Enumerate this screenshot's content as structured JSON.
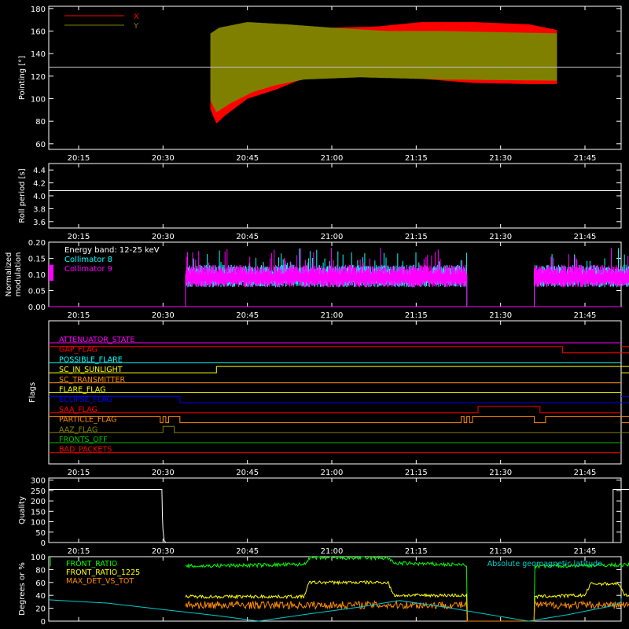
{
  "x_tick_labels": [
    "20:15",
    "20:30",
    "20:45",
    "21:00",
    "21:15",
    "21:30",
    "21:45"
  ],
  "chart_data": [
    {
      "type": "line",
      "ylabel": "Pointing [°]",
      "yticks": [
        "60",
        "80",
        "100",
        "120",
        "140",
        "160",
        "180"
      ],
      "ylim": [
        55,
        182
      ],
      "legend": [
        {
          "name": "X",
          "color": "#ff0000"
        },
        {
          "name": "Y",
          "color": "#808000"
        }
      ],
      "reference_line": 128,
      "series": [
        {
          "name": "X",
          "color": "#ff0000",
          "upper": [
            [
              28.5,
              152
            ],
            [
              29.5,
              158
            ],
            [
              32,
              162
            ],
            [
              40,
              165
            ],
            [
              50,
              163
            ],
            [
              58,
              164
            ],
            [
              66,
              168
            ],
            [
              75,
              168
            ],
            [
              85,
              166
            ],
            [
              90,
              161
            ]
          ],
          "lower": [
            [
              28.5,
              90
            ],
            [
              29.5,
              78
            ],
            [
              31,
              85
            ],
            [
              35,
              100
            ],
            [
              40,
              108
            ],
            [
              45,
              118
            ],
            [
              55,
              120
            ],
            [
              65,
              118
            ],
            [
              75,
              114
            ],
            [
              85,
              113
            ],
            [
              90,
              113
            ]
          ]
        },
        {
          "name": "Y",
          "color": "#808000",
          "upper": [
            [
              28.5,
              158
            ],
            [
              30,
              163
            ],
            [
              35,
              168
            ],
            [
              42,
              166
            ],
            [
              50,
              163
            ],
            [
              60,
              160
            ],
            [
              70,
              160
            ],
            [
              80,
              159
            ],
            [
              90,
              158
            ]
          ],
          "lower": [
            [
              28.5,
              98
            ],
            [
              29.5,
              88
            ],
            [
              32,
              96
            ],
            [
              36,
              106
            ],
            [
              40,
              112
            ],
            [
              45,
              117
            ],
            [
              55,
              119
            ],
            [
              70,
              117
            ],
            [
              90,
              116
            ]
          ]
        }
      ],
      "data_end": 90
    },
    {
      "type": "line",
      "ylabel": "Roll period [s]",
      "yticks": [
        "3.6",
        "3.8",
        "4.0",
        "4.2",
        "4.4"
      ],
      "ylim": [
        3.5,
        4.5
      ],
      "series": [
        {
          "name": "",
          "color": "#ffffff",
          "value": 4.08
        }
      ]
    },
    {
      "type": "line",
      "ylabel": "Normalized modulation",
      "yticks": [
        "0.00",
        "0.05",
        "0.10",
        "0.15",
        "0.20"
      ],
      "ylim": [
        0,
        0.2
      ],
      "annotation": "Energy band: 12-25 keV",
      "series": [
        {
          "name": "Collimator 8",
          "color": "#00ffff",
          "segments": [
            [
              24,
              74
            ],
            [
              86,
              110
            ]
          ],
          "base": 0.1
        },
        {
          "name": "Collimator 9",
          "color": "#ff00ff",
          "segments": [
            [
              24,
              74
            ],
            [
              86,
              110
            ]
          ],
          "base": 0.1
        }
      ]
    },
    {
      "type": "line",
      "ylabel": "Flags",
      "flags": [
        {
          "name": "ATTENUATOR_STATE",
          "color": "#ff00ff",
          "transitions": [],
          "init": 0
        },
        {
          "name": "GAP_FLAG",
          "color": "#ff0000",
          "transitions": [
            [
              1,
              1
            ],
            [
              75,
              1
            ],
            [
              91,
              0
            ],
            [
              116,
              1
            ]
          ],
          "init": 1
        },
        {
          "name": "POSSIBLE_FLARE",
          "color": "#00ffff",
          "transitions": [],
          "init": 0
        },
        {
          "name": "SC_IN_SUNLIGHT",
          "color": "#ffff00",
          "transitions": [
            [
              29.5,
              1
            ],
            [
              104,
              0
            ]
          ],
          "init": 0
        },
        {
          "name": "SC_TRANSMITTER",
          "color": "#ff8c00",
          "transitions": [],
          "init": 0
        },
        {
          "name": "FLARE_FLAG",
          "color": "#ffff00",
          "transitions": [],
          "init": 0
        },
        {
          "name": "ECLIPSE_FLAG",
          "color": "#0000ff",
          "transitions": [
            [
              23,
              0
            ],
            [
              104,
              1
            ]
          ],
          "init": 1
        },
        {
          "name": "SAA_FLAG",
          "color": "#ff0000",
          "transitions": [
            [
              76,
              1
            ],
            [
              87,
              0
            ]
          ],
          "init": 0
        },
        {
          "name": "PARTICLE_FLAG",
          "color": "#ff8c00",
          "transitions": [
            [
              19,
              1
            ],
            [
              19.5,
              0
            ],
            [
              20,
              1
            ],
            [
              20.5,
              0
            ],
            [
              21,
              1
            ],
            [
              23,
              0
            ],
            [
              73,
              1
            ],
            [
              73.5,
              0
            ],
            [
              74,
              1
            ],
            [
              74.5,
              0
            ],
            [
              75,
              1
            ],
            [
              86,
              0
            ],
            [
              88,
              1
            ],
            [
              110,
              0
            ]
          ],
          "init": 1
        },
        {
          "name": "AAZ_FLAG",
          "color": "#808000",
          "transitions": [
            [
              20,
              1
            ],
            [
              22,
              0
            ],
            [
              104,
              1
            ],
            [
              105,
              0
            ]
          ],
          "init": 0
        },
        {
          "name": "FRONTS_OFF",
          "color": "#00c000",
          "transitions": [],
          "init": 0
        },
        {
          "name": "BAD_PACKETS",
          "color": "#ff0000",
          "transitions": [],
          "init": 0
        }
      ]
    },
    {
      "type": "line",
      "ylabel": "Quality",
      "yticks": [
        "0",
        "50",
        "100",
        "150",
        "200",
        "250",
        "300"
      ],
      "ylim": [
        0,
        310
      ],
      "series": [
        {
          "name": "",
          "color": "#ffffff",
          "points": [
            [
              0,
              255
            ],
            [
              19.8,
              255
            ],
            [
              19.9,
              120
            ],
            [
              20,
              60
            ],
            [
              20.2,
              10
            ],
            [
              20.5,
              0
            ],
            [
              100,
              0
            ],
            [
              100,
              255
            ],
            [
              110,
              255
            ]
          ]
        }
      ]
    },
    {
      "type": "line",
      "ylabel": "Degrees or %",
      "yticks": [
        "0",
        "20",
        "40",
        "60",
        "80",
        "100"
      ],
      "ylim": [
        0,
        100
      ],
      "annotation": "Absolute geomagnetic latitude",
      "series": [
        {
          "name": "FRONT_RATIO",
          "color": "#00ff00",
          "points": [
            [
              24,
              85
            ],
            [
              30,
              86
            ],
            [
              45,
              88
            ],
            [
              46,
              98
            ],
            [
              60,
              98
            ],
            [
              61,
              90
            ],
            [
              74,
              87
            ],
            [
              74,
              0
            ],
            [
              86,
              0
            ],
            [
              86,
              85
            ],
            [
              98,
              87
            ],
            [
              99,
              87
            ],
            [
              110,
              87
            ],
            [
              110,
              0
            ]
          ]
        },
        {
          "name": "FRONT_RATIO_1225",
          "color": "#ffff00",
          "points": [
            [
              24,
              38
            ],
            [
              45,
              38
            ],
            [
              46,
              60
            ],
            [
              60,
              60
            ],
            [
              61,
              40
            ],
            [
              74,
              40
            ],
            [
              74,
              0
            ],
            [
              86,
              0
            ],
            [
              86,
              38
            ],
            [
              95,
              40
            ],
            [
              96,
              58
            ],
            [
              101,
              58
            ],
            [
              102,
              40
            ],
            [
              110,
              40
            ],
            [
              110,
              0
            ]
          ]
        },
        {
          "name": "MAX_DET_VS_TOT",
          "color": "#ff8c00",
          "points": [
            [
              24,
              25
            ],
            [
              74,
              25
            ],
            [
              74,
              0
            ],
            [
              86,
              0
            ],
            [
              86,
              25
            ],
            [
              110,
              25
            ],
            [
              110,
              0
            ]
          ]
        },
        {
          "name": "Absolute geomagnetic latitude",
          "color": "#00cccc",
          "points": [
            [
              0,
              33
            ],
            [
              10,
              28
            ],
            [
              20,
              18
            ],
            [
              30,
              8
            ],
            [
              37,
              0
            ],
            [
              45,
              10
            ],
            [
              55,
              22
            ],
            [
              62,
              32
            ],
            [
              70,
              22
            ],
            [
              78,
              10
            ],
            [
              85,
              0
            ],
            [
              92,
              10
            ],
            [
              100,
              24
            ],
            [
              105,
              30
            ],
            [
              110,
              35
            ],
            [
              114,
              36
            ],
            [
              118,
              34
            ]
          ]
        }
      ]
    }
  ]
}
